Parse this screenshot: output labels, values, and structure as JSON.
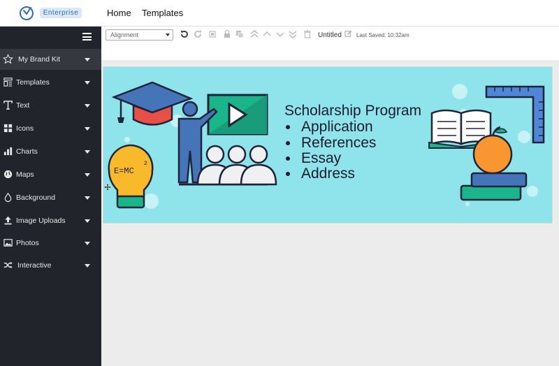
{
  "header": {
    "badge": "Enterprise",
    "nav": [
      "Home",
      "Templates"
    ]
  },
  "sidebar": {
    "items": [
      {
        "label": "My Brand Kit",
        "icon": "star-icon"
      },
      {
        "label": "Templates",
        "icon": "templates-icon"
      },
      {
        "label": "Text",
        "icon": "text-icon"
      },
      {
        "label": "Icons",
        "icon": "icons-grid-icon"
      },
      {
        "label": "Charts",
        "icon": "bar-chart-icon"
      },
      {
        "label": "Maps",
        "icon": "globe-icon"
      },
      {
        "label": "Background",
        "icon": "drop-icon"
      },
      {
        "label": "Image Uploads",
        "icon": "upload-icon"
      },
      {
        "label": "Photos",
        "icon": "photo-icon"
      },
      {
        "label": "Interactive",
        "icon": "shuffle-icon"
      }
    ]
  },
  "toolbar": {
    "alignment_value": "Alignment",
    "doc_title": "Untitled",
    "last_saved": "Last Saved: 10:32am"
  },
  "banner": {
    "title": "Scholarship Program",
    "bullets": [
      "Application",
      "References",
      "Essay",
      "Address"
    ],
    "equation": "E=MC",
    "equation_exp": "2"
  },
  "colors": {
    "accent": "#2f6db5",
    "sidebar_bg": "#21242b",
    "banner_bg": "#8fe3ea"
  }
}
